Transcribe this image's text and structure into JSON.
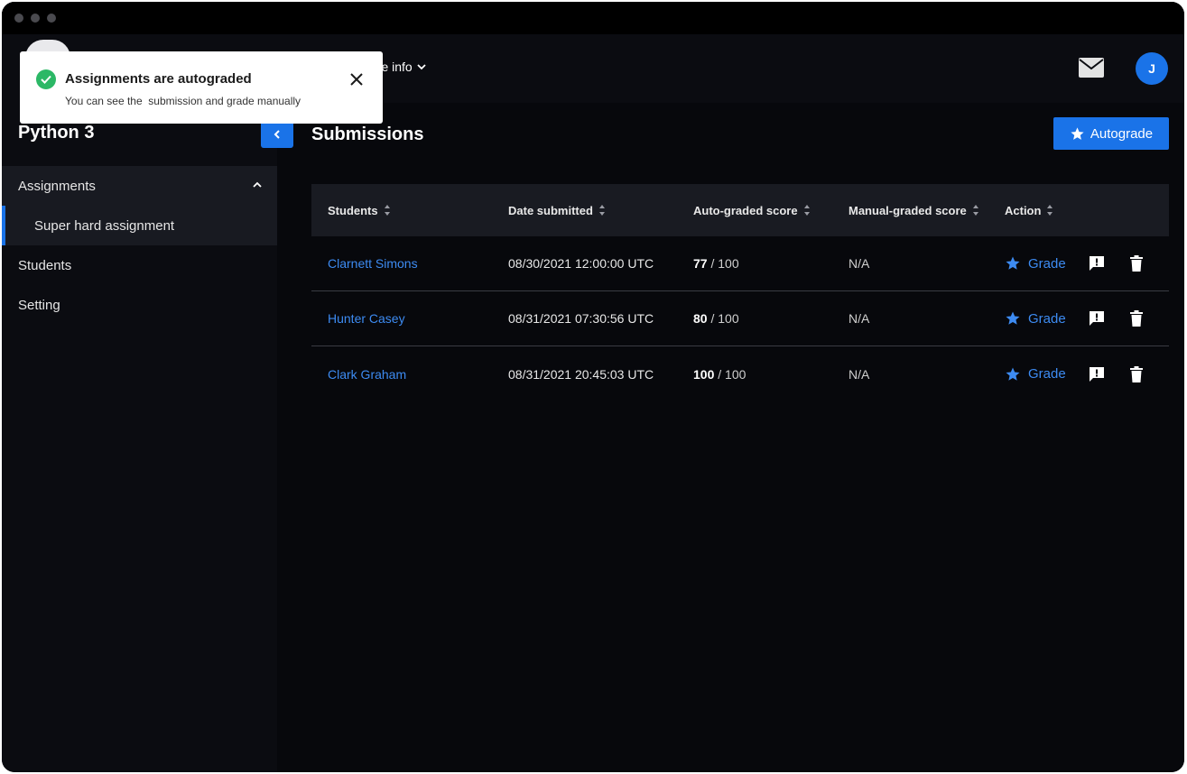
{
  "toast": {
    "title": "Assignments are autograded",
    "message": "You can see the  submission and grade manually",
    "check_icon": "check-circle-icon",
    "close_icon": "close-icon",
    "accent": "#2cb866"
  },
  "topbar": {
    "more_info_label": "ore info",
    "mail_icon": "mail-icon",
    "avatar_initial": "J"
  },
  "sidebar": {
    "course_title": "Python 3",
    "items": [
      {
        "label": "Assignments",
        "expanded": true,
        "children": [
          {
            "label": "Super hard assignment",
            "active": true
          }
        ]
      },
      {
        "label": "Students"
      },
      {
        "label": "Setting"
      }
    ]
  },
  "main": {
    "title": "Submissions",
    "autograde_label": "Autograde",
    "accent": "#1a73e8",
    "columns": [
      "Students",
      "Date submitted",
      "Auto-graded score",
      "Manual-graded score",
      "Action"
    ],
    "grade_label": "Grade",
    "rows": [
      {
        "student": "Clarnett Simons",
        "date": "08/30/2021 12:00:00 UTC",
        "score": "77",
        "max": " / 100",
        "manual": "N/A"
      },
      {
        "student": "Hunter Casey",
        "date": "08/31/2021 07:30:56 UTC",
        "score": "80",
        "max": " / 100",
        "manual": "N/A"
      },
      {
        "student": "Clark Graham",
        "date": "08/31/2021 20:45:03 UTC",
        "score": "100",
        "max": " / 100",
        "manual": "N/A"
      }
    ]
  }
}
